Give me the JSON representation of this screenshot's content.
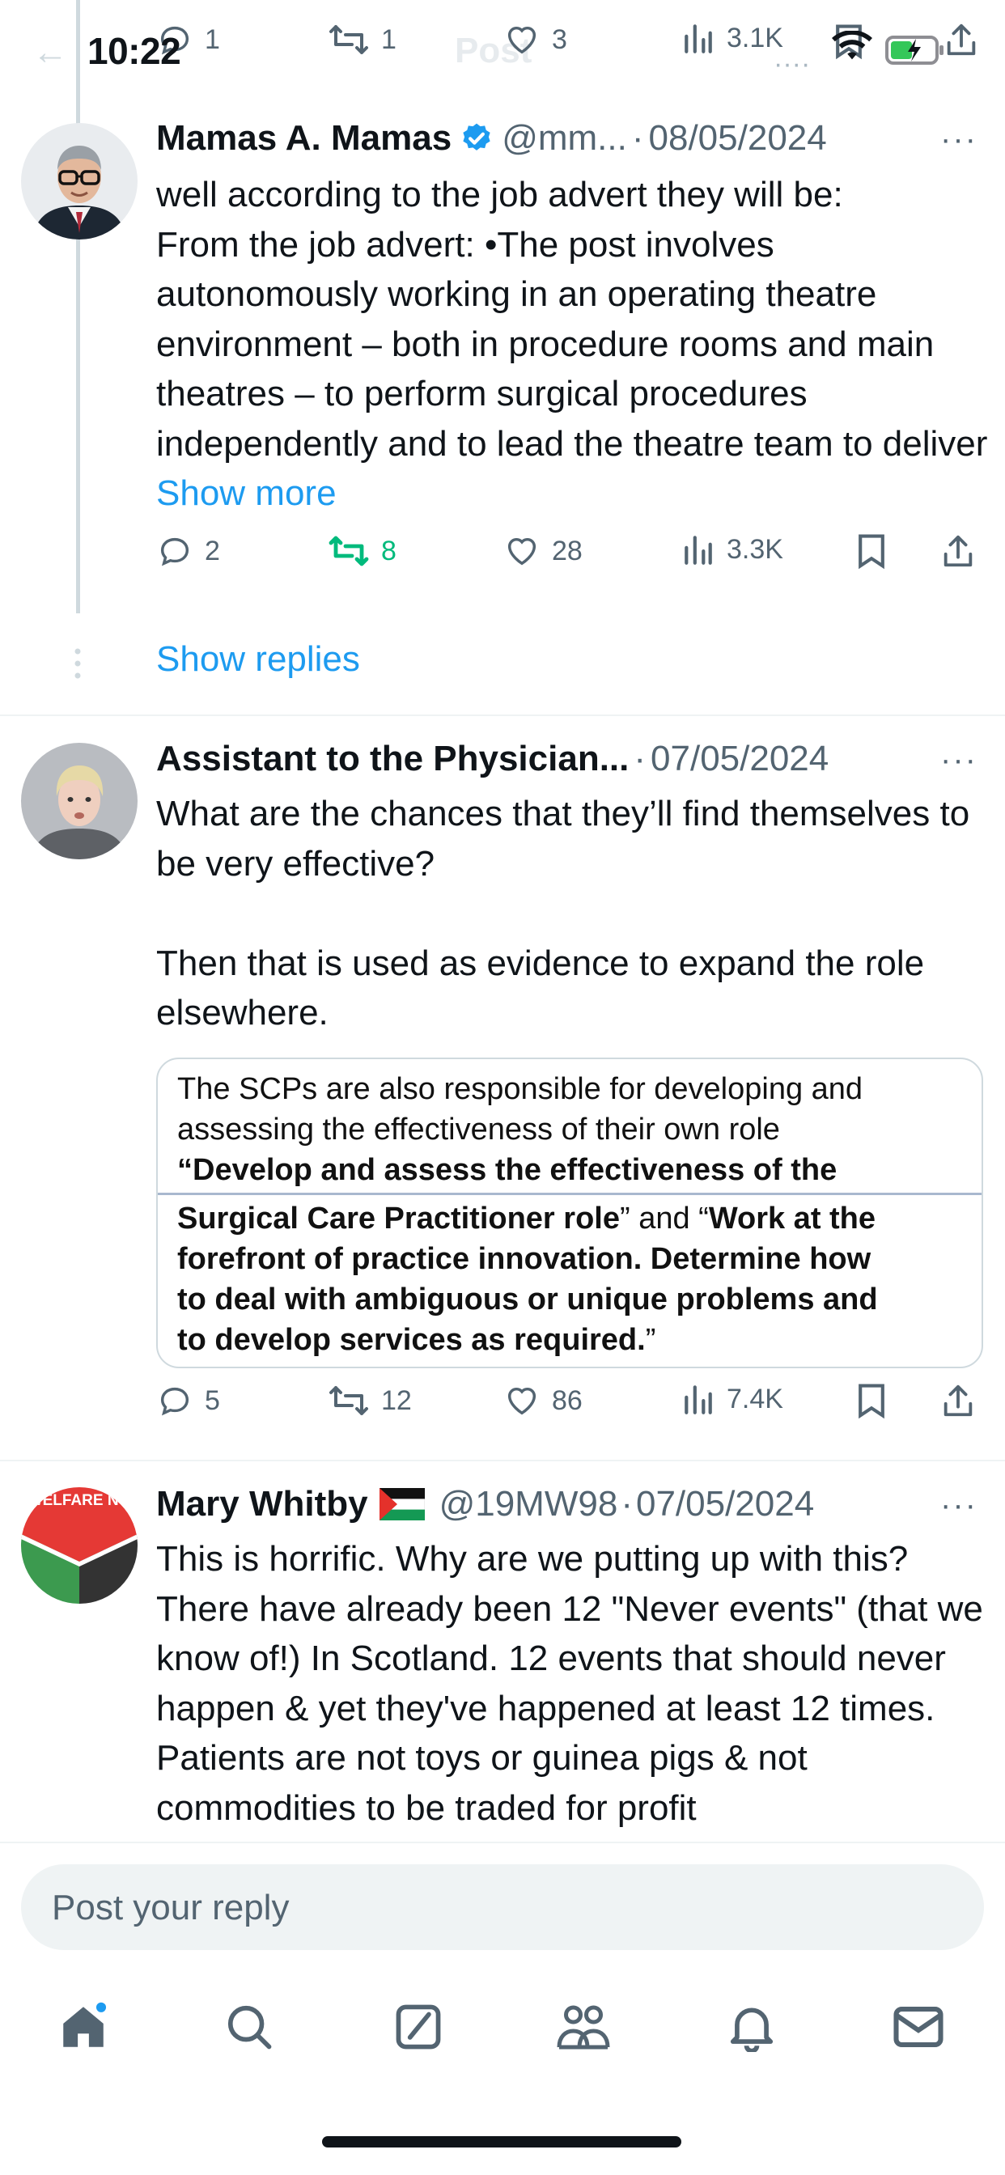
{
  "status_bar": {
    "time": "10:22"
  },
  "header": {
    "back_label": "←",
    "title": "Post"
  },
  "parent_actions": {
    "replies": "1",
    "reposts": "1",
    "likes": "3",
    "views": "3.1K"
  },
  "tweets": [
    {
      "name": "Mamas A. Mamas",
      "verified": true,
      "handle": "@mm...",
      "separator": "·",
      "date": "08/05/2024",
      "text": "well according to the job advert they will be:\nFrom the job advert:  •The post involves autonomously working in an operating theatre environment – both in procedure rooms and main theatres – to perform surgical procedures independently and to lead the theatre team to deliver ",
      "show_more": "Show more",
      "actions": {
        "replies": "2",
        "reposts": "8",
        "likes": "28",
        "views": "3.3K"
      },
      "reposted": true
    },
    {
      "name": "Assistant to the Physician...",
      "separator": "·",
      "date": "07/05/2024",
      "text": "What are the chances that they’ll find themselves to be very effective?\n\nThen that is used as evidence to expand the role elsewhere.",
      "quote_image": {
        "line1": "The SCPs are also responsible for developing and",
        "line2": "assessing the effectiveness of their own role",
        "line3": "“Develop and assess the effectiveness of the",
        "line4a": "Surgical Care Practitioner role",
        "line4b": "” and “",
        "line4c": "Work at the",
        "line5": "forefront of practice innovation. Determine how",
        "line6": "to deal with ambiguous or unique problems and",
        "line7a": "to develop services as required.",
        "line7b": "”"
      },
      "actions": {
        "replies": "5",
        "reposts": "12",
        "likes": "86",
        "views": "7.4K"
      }
    },
    {
      "name": "Mary Whitby",
      "flag": "🇵🇸",
      "handle": "@19MW98",
      "separator": "·",
      "date": "07/05/2024",
      "text": "This is horrific. Why are we putting up with this? There have already been 12 \"Never events\" (that we know of!) In Scotland. 12 events that should never happen & yet they've happened at least 12 times. Patients are not toys or guinea pigs & not commodities to be traded for profit",
      "avatar_text": "WELFARE NO"
    }
  ],
  "show_replies": "Show replies",
  "more_label": "···",
  "reply_bar": {
    "placeholder": "Post your reply"
  },
  "nav": [
    "home-icon",
    "search-icon",
    "compose-icon",
    "communities-icon",
    "notifications-icon",
    "messages-icon"
  ],
  "colors": {
    "accent": "#1d9bf0",
    "repost_green": "#00ba7c",
    "muted": "#536471",
    "text": "#0f1419"
  }
}
